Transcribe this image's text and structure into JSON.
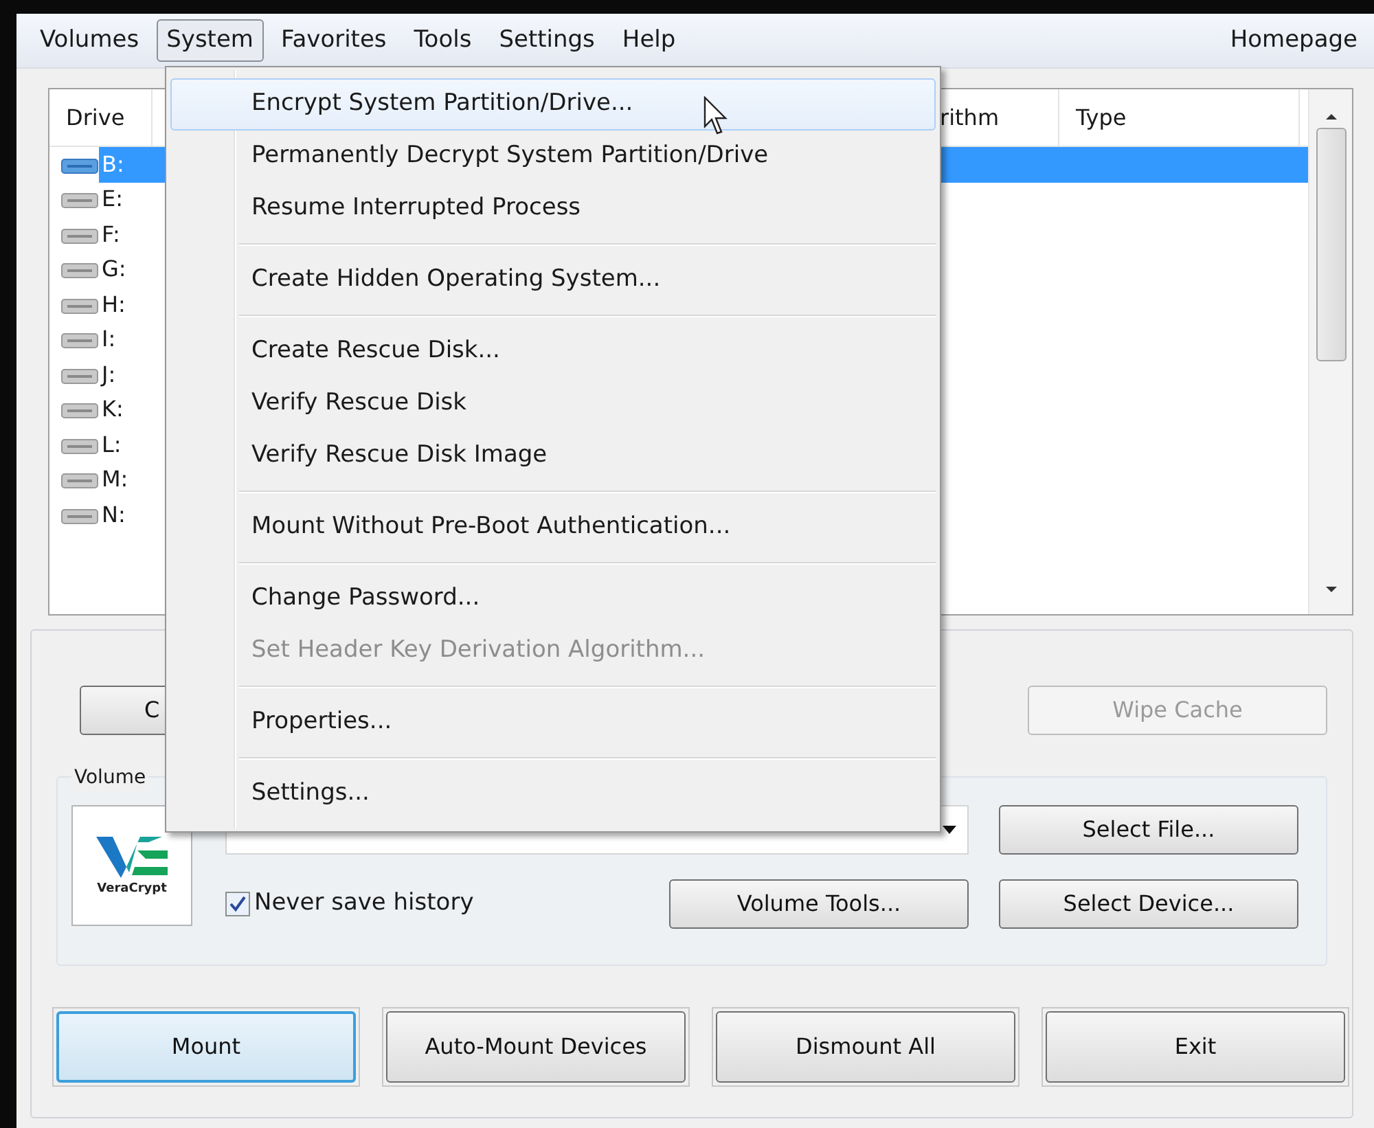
{
  "menu_bar": {
    "items": [
      {
        "label": "Volumes",
        "selected": false
      },
      {
        "label": "System",
        "selected": true
      },
      {
        "label": "Favorites",
        "selected": false
      },
      {
        "label": "Tools",
        "selected": false
      },
      {
        "label": "Settings",
        "selected": false
      },
      {
        "label": "Help",
        "selected": false
      }
    ],
    "homepage": "Homepage"
  },
  "dropdown": {
    "items": [
      {
        "kind": "item",
        "label": "Encrypt System Partition/Drive...",
        "highlighted": true,
        "disabled": false
      },
      {
        "kind": "item",
        "label": "Permanently Decrypt System Partition/Drive",
        "highlighted": false,
        "disabled": false
      },
      {
        "kind": "item",
        "label": "Resume Interrupted Process",
        "highlighted": false,
        "disabled": false
      },
      {
        "kind": "separator"
      },
      {
        "kind": "item",
        "label": "Create Hidden Operating System...",
        "highlighted": false,
        "disabled": false
      },
      {
        "kind": "separator"
      },
      {
        "kind": "item",
        "label": "Create Rescue Disk...",
        "highlighted": false,
        "disabled": false
      },
      {
        "kind": "item",
        "label": "Verify Rescue Disk",
        "highlighted": false,
        "disabled": false
      },
      {
        "kind": "item",
        "label": "Verify Rescue Disk Image",
        "highlighted": false,
        "disabled": false
      },
      {
        "kind": "separator"
      },
      {
        "kind": "item",
        "label": "Mount Without Pre-Boot Authentication...",
        "highlighted": false,
        "disabled": false
      },
      {
        "kind": "separator"
      },
      {
        "kind": "item",
        "label": "Change Password...",
        "highlighted": false,
        "disabled": false
      },
      {
        "kind": "item",
        "label": "Set Header Key Derivation Algorithm...",
        "highlighted": false,
        "disabled": true
      },
      {
        "kind": "separator"
      },
      {
        "kind": "item",
        "label": "Properties...",
        "highlighted": false,
        "disabled": false
      },
      {
        "kind": "separator"
      },
      {
        "kind": "item",
        "label": "Settings...",
        "highlighted": false,
        "disabled": false
      }
    ]
  },
  "drive_list": {
    "columns": [
      "Drive",
      "rithm",
      "Type"
    ],
    "rows": [
      {
        "drive": "B:",
        "selected": true
      },
      {
        "drive": "E:",
        "selected": false
      },
      {
        "drive": "F:",
        "selected": false
      },
      {
        "drive": "G:",
        "selected": false
      },
      {
        "drive": "H:",
        "selected": false
      },
      {
        "drive": "I:",
        "selected": false
      },
      {
        "drive": "J:",
        "selected": false
      },
      {
        "drive": "K:",
        "selected": false
      },
      {
        "drive": "L:",
        "selected": false
      },
      {
        "drive": "M:",
        "selected": false
      },
      {
        "drive": "N:",
        "selected": false
      }
    ]
  },
  "top_buttons": [
    {
      "label": "C",
      "disabled": false
    },
    {
      "label": "Wipe Cache",
      "disabled": true
    }
  ],
  "volume": {
    "group_label": "Volume",
    "logo_text": "VeraCrypt",
    "never_save_history": {
      "label": "Never save history",
      "checked": true
    },
    "buttons": [
      {
        "label": "Select File..."
      },
      {
        "label": "Volume Tools..."
      },
      {
        "label": "Select Device..."
      }
    ]
  },
  "action_buttons": [
    {
      "label": "Mount",
      "default": true
    },
    {
      "label": "Auto-Mount Devices",
      "default": false
    },
    {
      "label": "Dismount All",
      "default": false
    },
    {
      "label": "Exit",
      "default": false
    }
  ]
}
